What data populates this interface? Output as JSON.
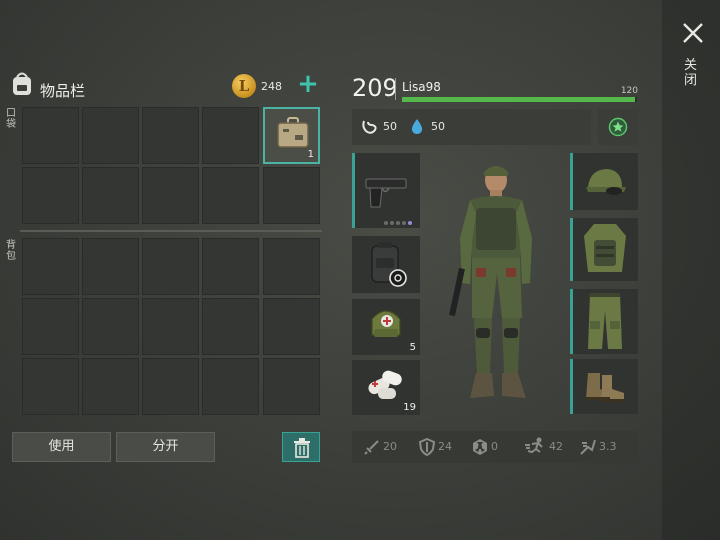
{
  "inventory": {
    "title": "物品栏",
    "pocket_label": "口袋",
    "backpack_label": "背包",
    "coins": "248",
    "coin_symbol": "L",
    "slot_item_qty": "1",
    "use_button": "使用",
    "split_button": "分开"
  },
  "character": {
    "level": "209",
    "name": "Lisa98",
    "xp_max": "120",
    "xp_fraction": 0.99,
    "hunger": "50",
    "thirst": "50"
  },
  "equipment_left": [
    {
      "name": "pistol",
      "qty": ""
    },
    {
      "name": "backpack",
      "qty": ""
    },
    {
      "name": "bandage-bag",
      "qty": "5"
    },
    {
      "name": "bandages",
      "qty": "19"
    }
  ],
  "equipment_right": [
    "military-cap",
    "military-vest",
    "military-pants",
    "boots"
  ],
  "stats": {
    "attack": "20",
    "defense": "24",
    "radiation": "0",
    "speed": "42",
    "stealth": "3.3"
  },
  "close": {
    "label": "关闭"
  },
  "colors": {
    "accent": "#3aa295",
    "xp": "#55b84a",
    "coin": "#d9a536"
  }
}
